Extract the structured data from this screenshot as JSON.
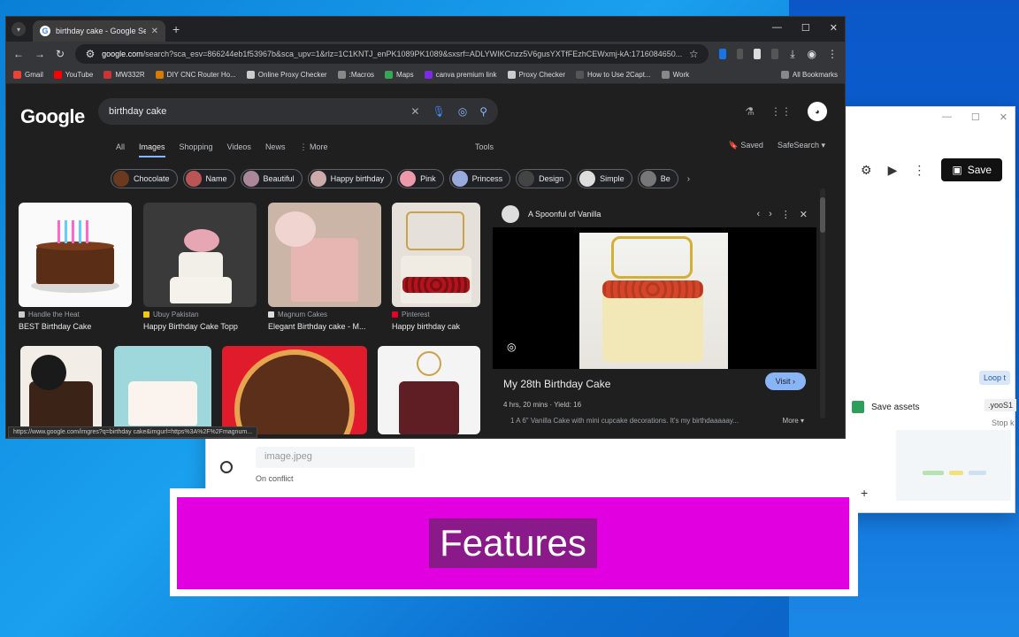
{
  "banner": {
    "text": "Features"
  },
  "background_app": {
    "save_label": "Save",
    "save_assets_label": "Save assets",
    "loop_label": "Loop t",
    "var_label": ".yooS1",
    "stop_label": "Stop k",
    "field_value": "image.jpeg",
    "conflict_label": "On conflict"
  },
  "chrome": {
    "tab_title": "birthday cake - Google Search",
    "url_host": "google.com",
    "url_rest": "/search?sca_esv=866244eb1f53967b&sca_upv=1&rlz=1C1KNTJ_enPK1089PK1089&sxsrf=ADLYWIKCnzz5V6gusYXTfFEzhCEWxmj-kA:1716084650...",
    "bookmarks": [
      {
        "label": "Gmail",
        "color": "#ea4335"
      },
      {
        "label": "YouTube",
        "color": "#ff0000"
      },
      {
        "label": "MW332R",
        "color": "#c33"
      },
      {
        "label": "DIY CNC Router Ho...",
        "color": "#d97a00"
      },
      {
        "label": "Online Proxy Checker",
        "color": "#ccc"
      },
      {
        "label": ":Macros",
        "color": "#888"
      },
      {
        "label": "Maps",
        "color": "#34a853"
      },
      {
        "label": "canva premium link",
        "color": "#7d2ae8"
      },
      {
        "label": "Proxy Checker",
        "color": "#ccc"
      },
      {
        "label": "How to Use 2Capt...",
        "color": "#555"
      },
      {
        "label": "Work",
        "color": "#888"
      }
    ],
    "all_bookmarks": "All Bookmarks",
    "status_url": "https://www.google.com/imgres?q=birthday cake&imgurl=https%3A%2F%2Fmagnum..."
  },
  "google": {
    "logo": "Google",
    "query": "birthday cake",
    "tabs": [
      "All",
      "Images",
      "Shopping",
      "Videos",
      "News",
      "⋮ More"
    ],
    "tools": "Tools",
    "saved": "Saved",
    "safesearch": "SafeSearch ▾",
    "chips": [
      {
        "label": "Chocolate",
        "color": "#6b3a1e"
      },
      {
        "label": "Name",
        "color": "#b55"
      },
      {
        "label": "Beautiful",
        "color": "#a89"
      },
      {
        "label": "Happy birthday",
        "color": "#caa"
      },
      {
        "label": "Pink",
        "color": "#e9a"
      },
      {
        "label": "Princess",
        "color": "#9ad"
      },
      {
        "label": "Design",
        "color": "#444"
      },
      {
        "label": "Simple",
        "color": "#ddd"
      },
      {
        "label": "Be",
        "color": "#777"
      }
    ],
    "results": [
      {
        "source": "Handle the Heat",
        "title": "BEST Birthday Cake",
        "src_color": "#ccc"
      },
      {
        "source": "Ubuy Pakistan",
        "title": "Happy Birthday Cake Topp",
        "src_color": "#f5c518"
      },
      {
        "source": "Magnum Cakes",
        "title": "Elegant Birthday cake - M...",
        "src_color": "#ddd"
      },
      {
        "source": "Pinterest",
        "title": "Happy birthday cak",
        "src_color": "#e60023"
      }
    ],
    "preview": {
      "site": "A Spoonful of Vanilla",
      "title": "My 28th Birthday Cake",
      "visit": "Visit ›",
      "meta": "4 hrs, 20 mins  ·  Yield: 16",
      "desc": "1 A 6\" Vanilla Cake with mini cupcake decorations. It's my birthdaaaaay...",
      "more": "More ▾"
    }
  }
}
